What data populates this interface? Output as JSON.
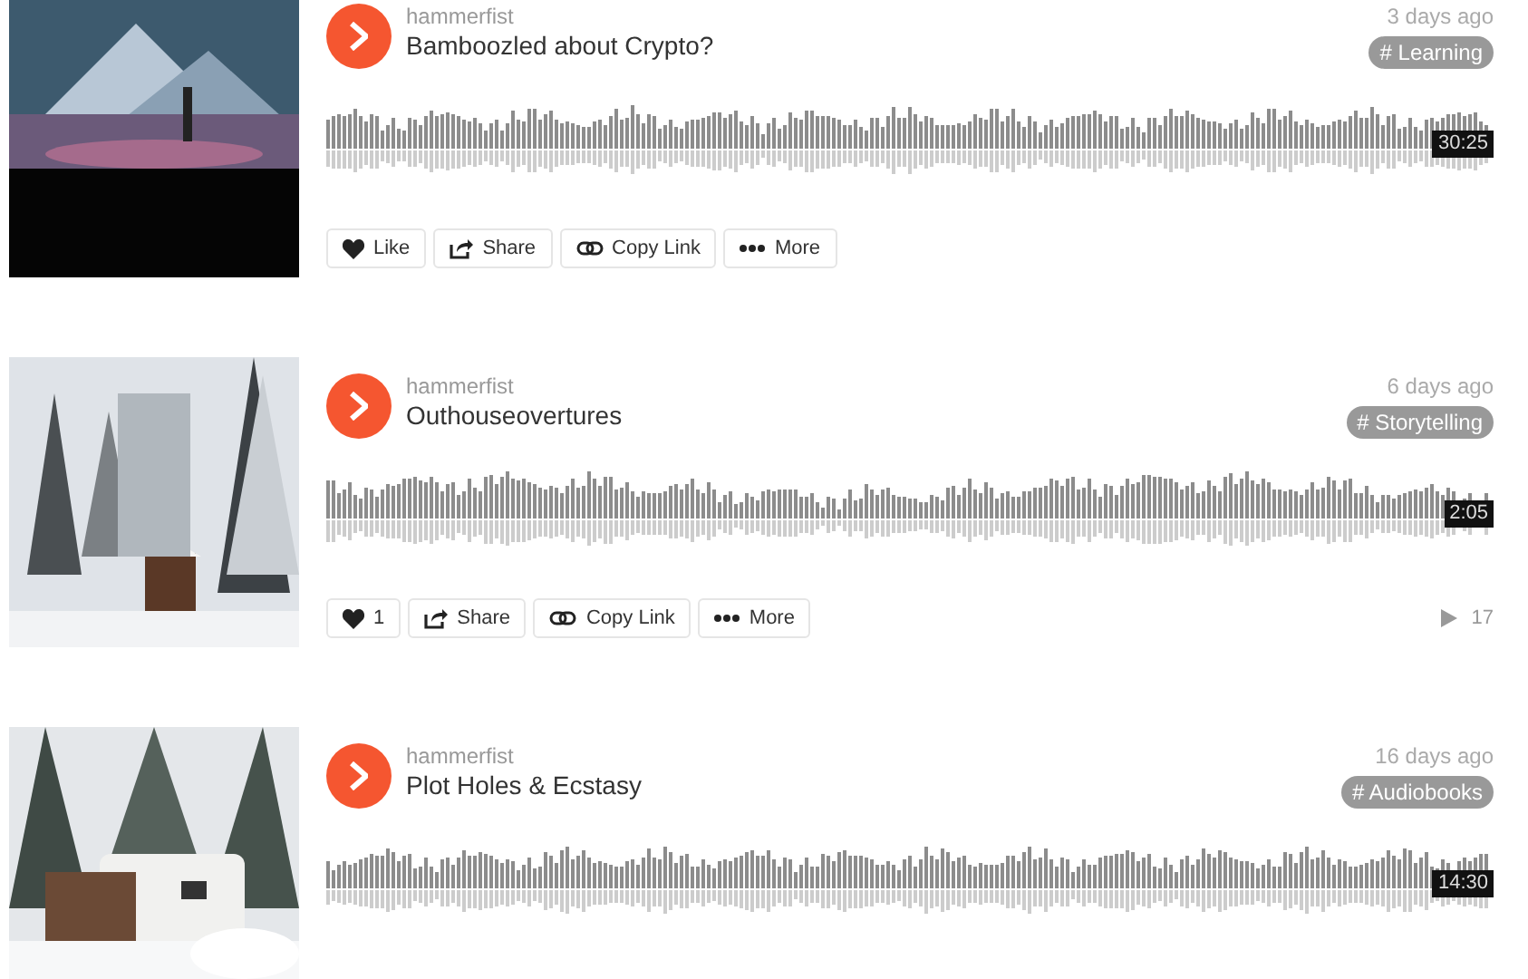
{
  "tracks": [
    {
      "user": "hammerfist",
      "title": "Bamboozled about Crypto?",
      "posted": "3 days ago",
      "tag": "# Learning",
      "duration": "30:25",
      "actions": [
        {
          "kind": "like",
          "label": "Like"
        },
        {
          "kind": "share",
          "label": "Share"
        },
        {
          "kind": "copy",
          "label": "Copy Link"
        },
        {
          "kind": "more",
          "label": "More"
        }
      ]
    },
    {
      "user": "hammerfist",
      "title": "Outhouseovertures",
      "posted": "6 days ago",
      "tag": "# Storytelling",
      "duration": "2:05",
      "actions": [
        {
          "kind": "like",
          "label": "1"
        },
        {
          "kind": "share",
          "label": "Share"
        },
        {
          "kind": "copy",
          "label": "Copy Link"
        },
        {
          "kind": "more",
          "label": "More"
        }
      ],
      "plays": "17"
    },
    {
      "user": "hammerfist",
      "title": "Plot Holes & Ecstasy",
      "posted": "16 days ago",
      "tag": "# Audiobooks",
      "duration": "14:30"
    }
  ]
}
